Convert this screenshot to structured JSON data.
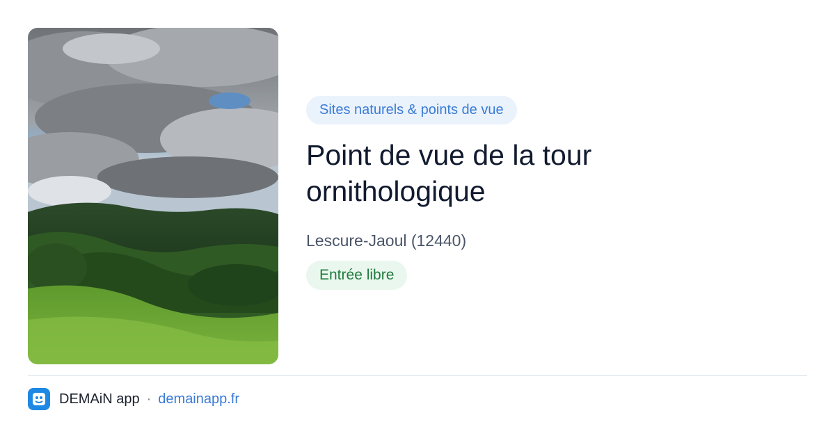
{
  "card": {
    "image": {
      "subject": "green hills under cloudy sky"
    },
    "category": "Sites naturels & points de vue",
    "title": "Point de vue de la tour ornithologique",
    "location": "Lescure-Jaoul (12440)",
    "access": "Entrée libre"
  },
  "footer": {
    "app_icon": "app-logo-icon",
    "app_name": "DEMAiN app",
    "separator": "·",
    "link": "demainapp.fr"
  },
  "colors": {
    "category_bg": "#eaf2fc",
    "category_text": "#3a7bd5",
    "access_bg": "#eaf7ee",
    "access_text": "#1e7a3c",
    "title": "#111a2e",
    "link": "#3a7bd5",
    "app_icon_bg": "#1e88e5"
  }
}
